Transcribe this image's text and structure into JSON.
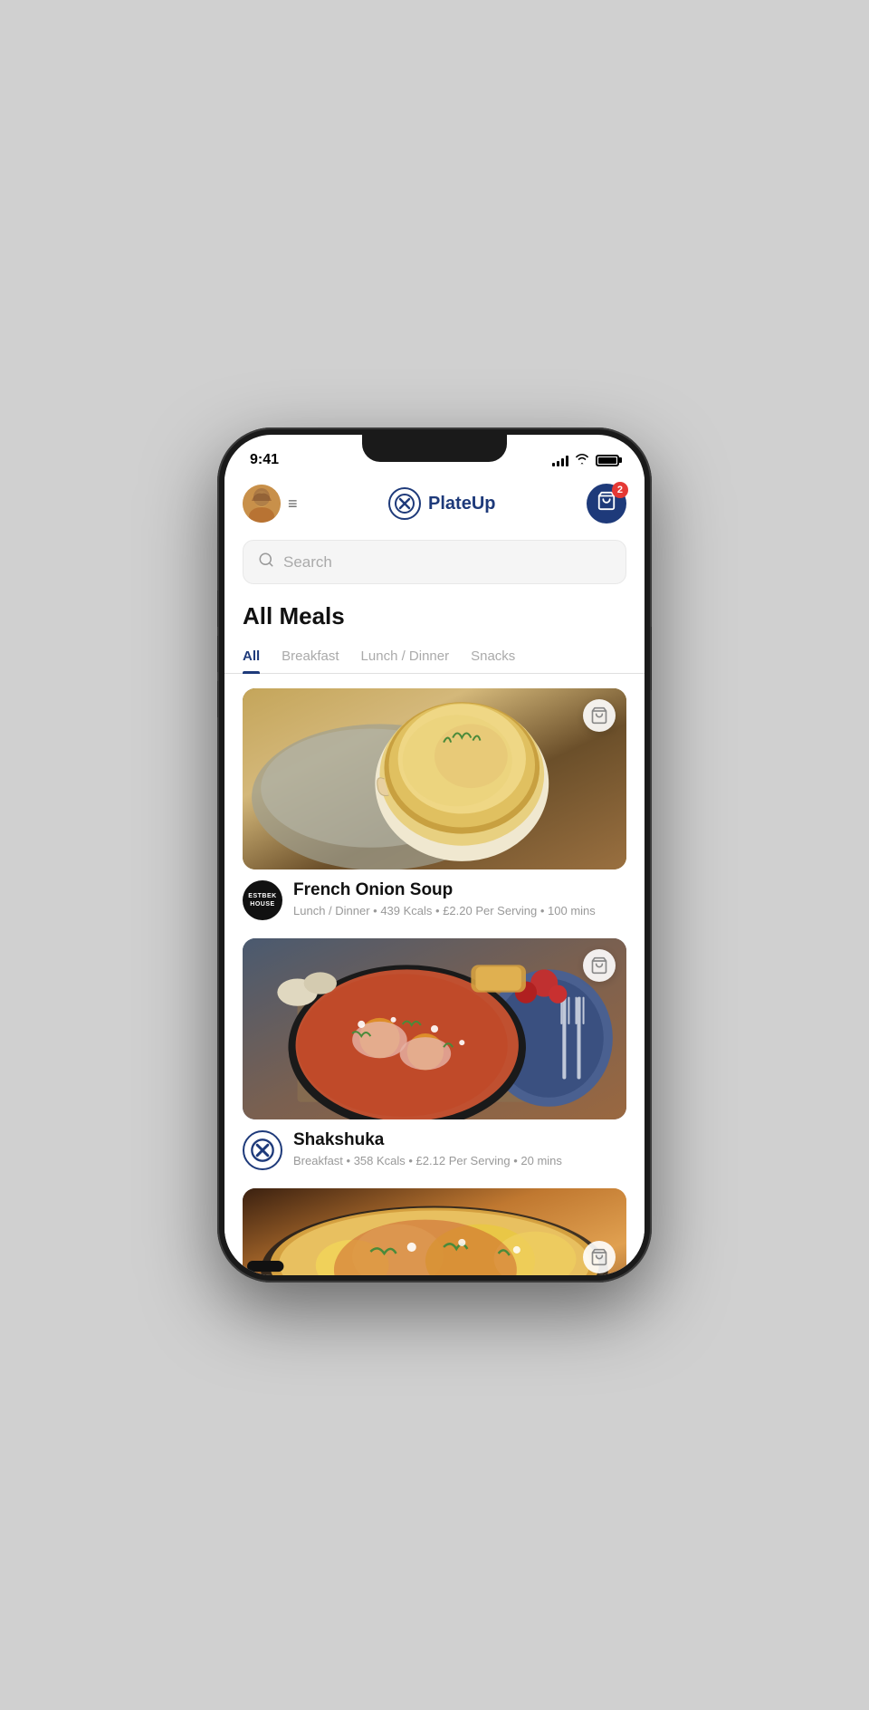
{
  "status": {
    "time": "9:41",
    "signal_bars": [
      4,
      6,
      8,
      10,
      12
    ],
    "battery_level": 100
  },
  "header": {
    "logo_text": "PlateUp",
    "logo_icon": "✕",
    "cart_count": "2",
    "menu_icon": "≡"
  },
  "search": {
    "placeholder": "Search"
  },
  "section": {
    "title": "All Meals"
  },
  "tabs": [
    {
      "id": "all",
      "label": "All",
      "active": true
    },
    {
      "id": "breakfast",
      "label": "Breakfast",
      "active": false
    },
    {
      "id": "lunch-dinner",
      "label": "Lunch / Dinner",
      "active": false
    },
    {
      "id": "snacks",
      "label": "Snacks",
      "active": false
    }
  ],
  "meals": [
    {
      "id": "french-onion-soup",
      "name": "French Onion Soup",
      "meta": "Lunch / Dinner • 439 Kcals • £2.20 Per Serving • 100 mins",
      "brand": "ESTBEK\nHOUSE",
      "brand_type": "text"
    },
    {
      "id": "shakshuka",
      "name": "Shakshuka",
      "meta": "Breakfast • 358 Kcals • £2.12 Per Serving • 20 mins",
      "brand": "✕",
      "brand_type": "logo"
    }
  ],
  "icons": {
    "cart": "🛒",
    "search": "🔍",
    "basket": "🧺"
  }
}
